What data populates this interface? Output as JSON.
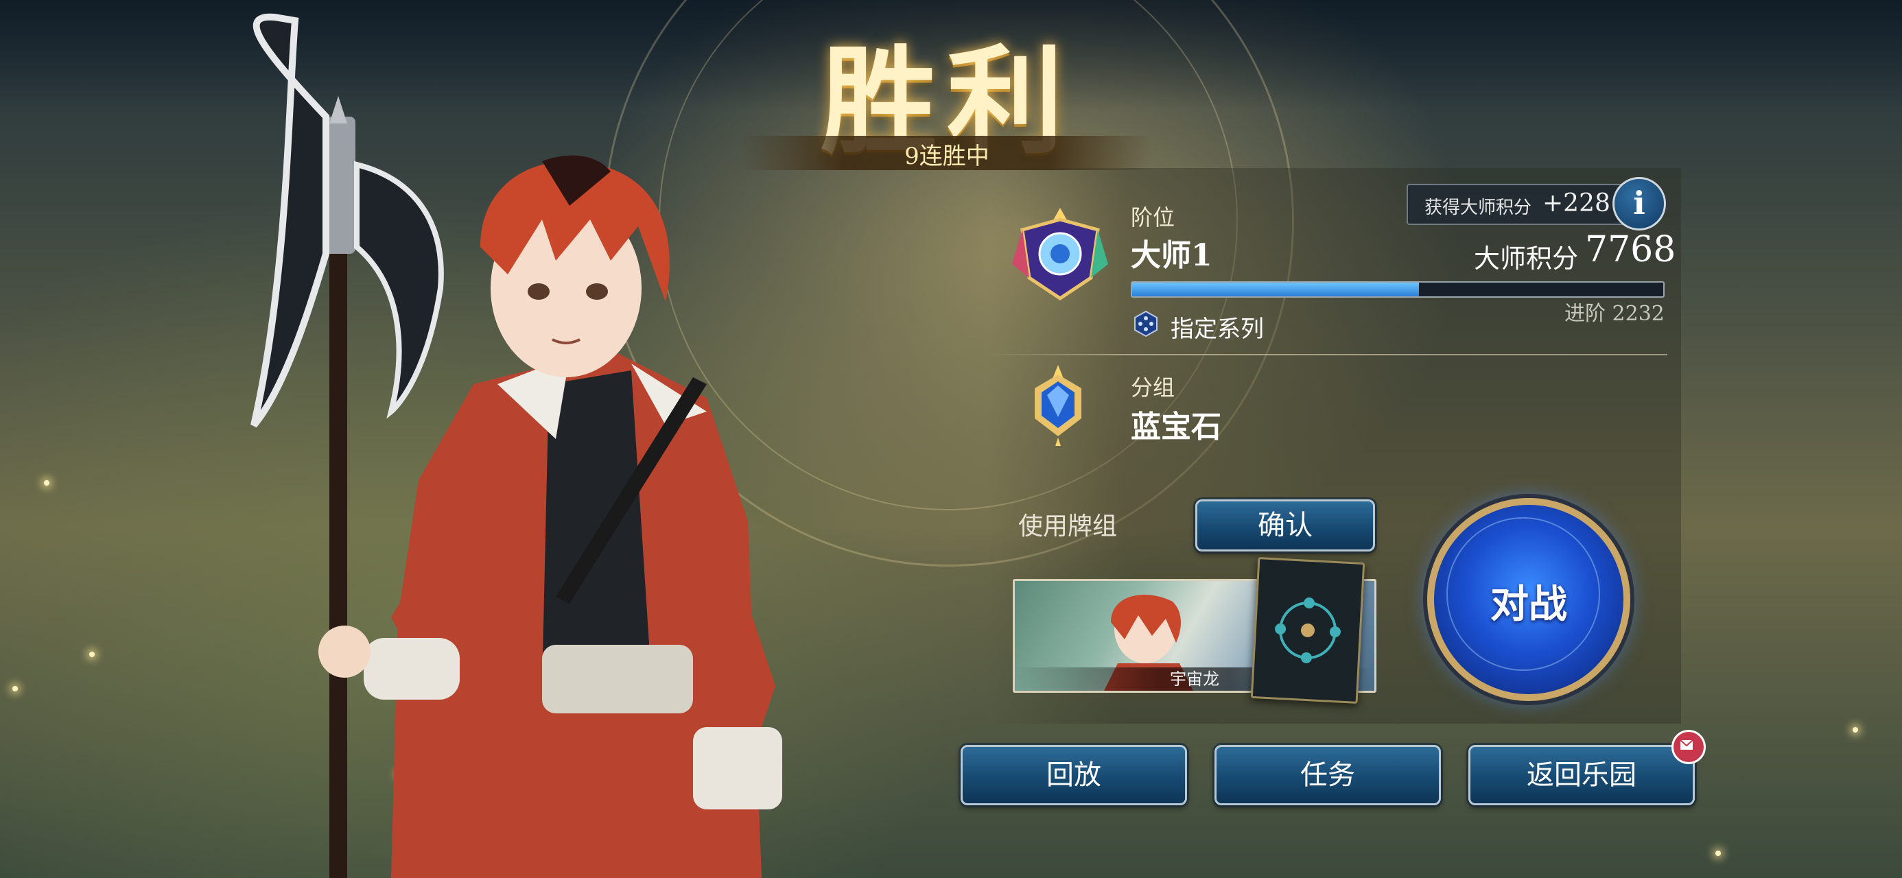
{
  "result": {
    "title": "胜利",
    "streak": "9连胜中"
  },
  "rank": {
    "label": "阶位",
    "name": "大师1",
    "points_gained_label": "获得大师积分",
    "points_gained": "+228",
    "info_icon_text": "i",
    "master_points_label": "大师积分",
    "master_points": "7768",
    "progress": 0.54,
    "promote_text": "进阶 2232",
    "series_label": "指定系列"
  },
  "group": {
    "label": "分组",
    "name": "蓝宝石"
  },
  "deck": {
    "label": "使用牌组",
    "confirm_label": "确认",
    "deck_name": "宇宙龙"
  },
  "battle": {
    "label": "对战"
  },
  "bottom": {
    "replay_label": "回放",
    "mission_label": "任务",
    "return_label": "返回乐园"
  },
  "colors": {
    "accent_blue": "#2c7fd6",
    "gold": "#caa766",
    "notification": "#c8364b"
  },
  "icons": [
    "rank-emblem-icon",
    "group-emblem-icon",
    "series-icon",
    "info-icon",
    "mail-icon"
  ]
}
